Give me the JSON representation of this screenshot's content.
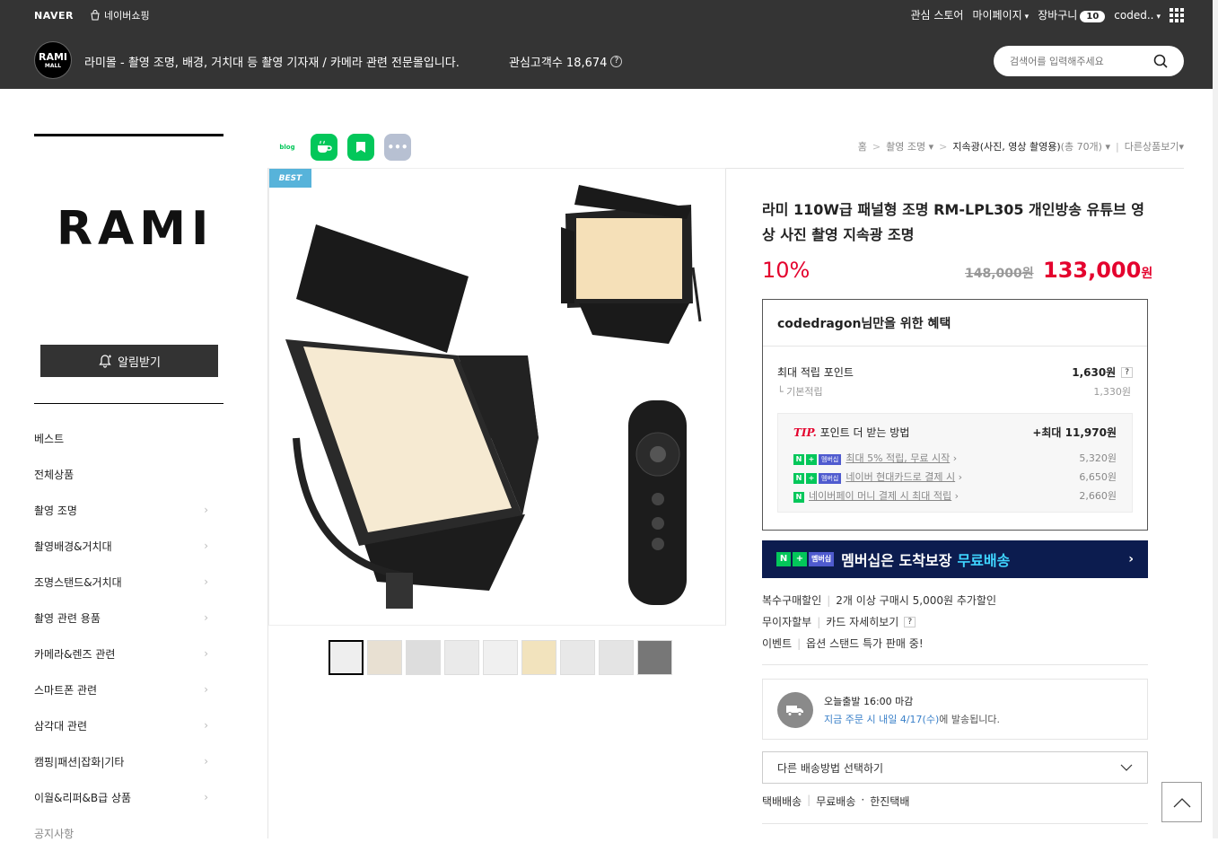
{
  "gnb": {
    "naver": "NAVER",
    "shopping": "네이버쇼핑",
    "interest_store": "관심 스토어",
    "mypage": "마이페이지",
    "cart": "장바구니",
    "cart_count": "10",
    "user": "coded.."
  },
  "store": {
    "logo_top": "RAMI",
    "logo_bottom": "MALL",
    "description": "라미몰 - 촬영 조명, 배경, 거치대 등 촬영 기자재 / 카메라 관련 전문몰입니다.",
    "follower_label": "관심고객수 18,674",
    "search_placeholder": "검색어를 입력해주세요"
  },
  "sidebar": {
    "brand": "RAMI",
    "alarm_button": "알림받기",
    "categories": [
      {
        "label": "베스트",
        "chevron": false
      },
      {
        "label": "전체상품",
        "chevron": false
      },
      {
        "label": "촬영 조명",
        "chevron": true
      },
      {
        "label": "촬영배경&거치대",
        "chevron": true
      },
      {
        "label": "조명스탠드&거치대",
        "chevron": true
      },
      {
        "label": "촬영 관련 용품",
        "chevron": true
      },
      {
        "label": "카메라&렌즈 관련",
        "chevron": true
      },
      {
        "label": "스마트폰 관련",
        "chevron": true
      },
      {
        "label": "삼각대 관련",
        "chevron": true
      },
      {
        "label": "캠핑|패션|잡화|기타",
        "chevron": true
      },
      {
        "label": "이월&리퍼&B급 상품",
        "chevron": true
      },
      {
        "label": "공지사항",
        "chevron": false
      }
    ]
  },
  "share": {
    "blog": "blog"
  },
  "breadcrumb": {
    "home": "홈",
    "cat1": "촬영 조명",
    "cat2": "지속광(사진, 영상 촬영용)",
    "count": "(총 70개)",
    "other": "다른상품보기"
  },
  "product": {
    "badge": "BEST",
    "title": "라미 110W급 패널형 조명 RM-LPL305 개인방송 유튜브 영상 사진 촬영 지속광 조명",
    "discount": "10%",
    "original_price": "148,000원",
    "price": "133,000",
    "price_unit": "원"
  },
  "benefit": {
    "title": "codedragon님만을 위한 혜택",
    "max_point_label": "최대 적립 포인트",
    "max_point_value": "1,630원",
    "basic_label": "기본적립",
    "basic_value": "1,330원",
    "tip_label": "TIP.",
    "tip_title": "포인트 더 받는 방법",
    "tip_max": "+최대 11,970원",
    "tip_rows": [
      {
        "text": "최대 5% 적립, 무료 시작",
        "value": "5,320원",
        "badge": "멤버십"
      },
      {
        "text": "네이버 현대카드로 결제 시",
        "value": "6,650원",
        "badge": "멤버십"
      },
      {
        "text": "네이버페이 머니 결제 시 최대 적립",
        "value": "2,660원",
        "badge": ""
      }
    ]
  },
  "banner": {
    "badge": "멤버십",
    "text_white": "멤버십은 도착보장",
    "text_highlight": "무료배송"
  },
  "extras": [
    {
      "label": "복수구매할인",
      "value": "2개 이상 구매시 5,000원 추가할인"
    },
    {
      "label": "무이자할부",
      "value": "카드 자세히보기"
    },
    {
      "label": "이벤트",
      "value": "옵션 스탠드 특가 판매 중!"
    }
  ],
  "shipping": {
    "line1": "오늘출발 16:00 마감",
    "line2_highlight": "지금 주문 시 내일 4/17(수)",
    "line2_rest": "에 발송됩니다.",
    "select_label": "다른 배송방법 선택하기",
    "foot1": "택배배송",
    "foot2": "무료배송",
    "foot3": "한진택배"
  },
  "colors": {
    "accent_red": "#e4032e",
    "naver_green": "#03c75a",
    "banner_navy": "#0c1c4f",
    "topbar": "#343434"
  }
}
